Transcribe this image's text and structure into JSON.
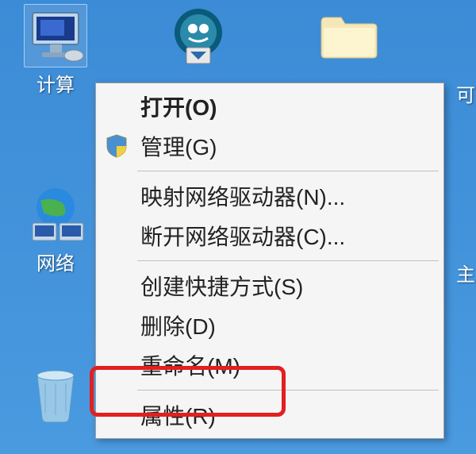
{
  "desktop": {
    "computer_label": "计算",
    "network_label": "网络",
    "app_label": "",
    "folder_label": "",
    "partial_right_1": "可",
    "partial_right_2": "主"
  },
  "menu": {
    "open": "打开(O)",
    "manage": "管理(G)",
    "map_drive": "映射网络驱动器(N)...",
    "disconnect_drive": "断开网络驱动器(C)...",
    "create_shortcut": "创建快捷方式(S)",
    "delete": "删除(D)",
    "rename": "重命名(M)",
    "properties": "属性(R)"
  }
}
